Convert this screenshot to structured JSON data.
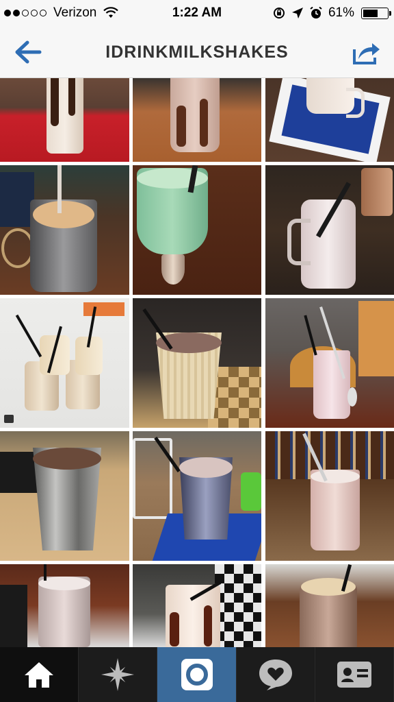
{
  "status_bar": {
    "carrier": "Verizon",
    "time": "1:22 AM",
    "battery_percent": "61%",
    "battery_level": 0.61,
    "signal_bars_filled": 2,
    "signal_bars_total": 5
  },
  "nav": {
    "title": "IDRINKMILKSHAKES",
    "back_icon": "back-arrow-icon",
    "share_icon": "share-icon"
  },
  "colors": {
    "accent": "#3a6a9a",
    "nav_blue": "#2e6db4",
    "tab_bar": "#1c1c1c"
  },
  "tabs": [
    {
      "name": "home",
      "icon": "home-icon",
      "active": false
    },
    {
      "name": "explore",
      "icon": "explore-star-icon",
      "active": false
    },
    {
      "name": "camera",
      "icon": "camera-icon",
      "active": true
    },
    {
      "name": "activity",
      "icon": "activity-heart-icon",
      "active": false
    },
    {
      "name": "profile",
      "icon": "profile-card-icon",
      "active": false
    }
  ],
  "photos": [
    {
      "id": 1,
      "description": "chocolate milkshake on red table"
    },
    {
      "id": 2,
      "description": "chocolate milkshake on wooden table"
    },
    {
      "id": 3,
      "description": "milkshake mug on blue coaster"
    },
    {
      "id": 4,
      "description": "milkshake in metal cup"
    },
    {
      "id": 5,
      "description": "mint milkshake in tall glass"
    },
    {
      "id": 6,
      "description": "milkshake in mason jar mug"
    },
    {
      "id": 7,
      "description": "four milkshake jars"
    },
    {
      "id": 8,
      "description": "milkshake in paper cup"
    },
    {
      "id": 9,
      "description": "strawberry milkshake with spoon"
    },
    {
      "id": 10,
      "description": "milkshake in steel tumbler"
    },
    {
      "id": 11,
      "description": "milkshake in steel tumbler on blue tray"
    },
    {
      "id": 12,
      "description": "pink milkshake in glass"
    },
    {
      "id": 13,
      "description": "milkshake in glass"
    },
    {
      "id": 14,
      "description": "milkshake with chocolate swirl"
    },
    {
      "id": 15,
      "description": "milkshake in mason jar"
    }
  ]
}
